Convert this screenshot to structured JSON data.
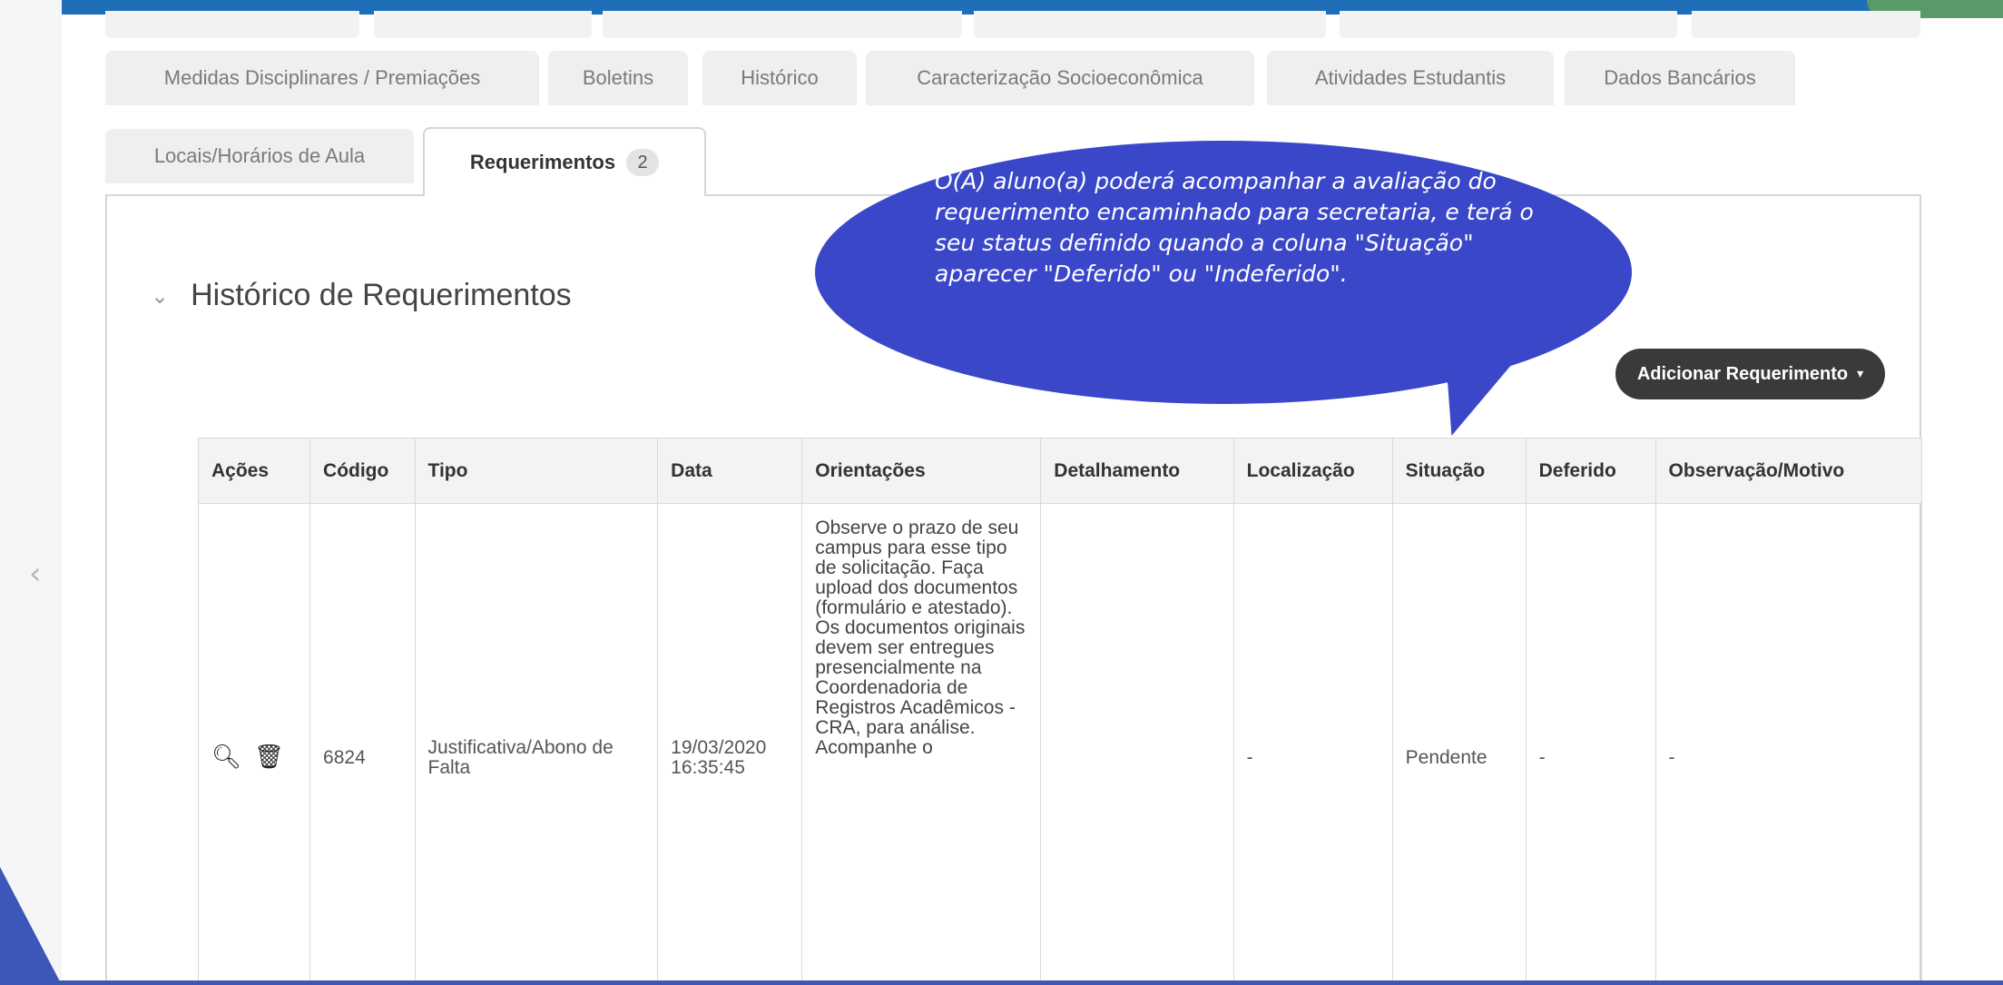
{
  "tabs_row1": [
    {
      "label": "Medidas Disciplinares / Premiações"
    },
    {
      "label": "Boletins"
    },
    {
      "label": "Histórico"
    },
    {
      "label": "Caracterização Socioeconômica"
    },
    {
      "label": "Atividades Estudantis"
    },
    {
      "label": "Dados Bancários"
    }
  ],
  "tabs_row2": [
    {
      "label": "Locais/Horários de Aula"
    },
    {
      "label": "Requerimentos",
      "badge": "2"
    }
  ],
  "section": {
    "title": "Histórico de Requerimentos"
  },
  "add_button": {
    "label": "Adicionar Requerimento"
  },
  "table": {
    "headers": [
      "Ações",
      "Código",
      "Tipo",
      "Data",
      "Orientações",
      "Detalhamento",
      "Localização",
      "Situação",
      "Deferido",
      "Observação/Motivo"
    ],
    "rows": [
      {
        "codigo": "6824",
        "tipo": "Justificativa/Abono de Falta",
        "data": "19/03/2020 16:35:45",
        "orientacoes": "Observe o prazo de seu campus para esse tipo de solicitação. Faça upload dos documentos (formulário e atestado). Os documentos originais devem ser entregues presencialmente na Coordenadoria de Registros Acadêmicos - CRA, para análise. Acompanhe o",
        "detalhamento": "",
        "localizacao": "-",
        "situacao": "Pendente",
        "deferido": "-",
        "observacao": "-"
      }
    ]
  },
  "annotation": {
    "text": "O(A) aluno(a) poderá acompanhar a avaliação do requerimento encaminhado para secretaria, e terá o seu status definido quando a coluna \"Situação\" aparecer \"Deferido\" ou \"Indeferido\"."
  },
  "icons": {
    "search": "magnifier-icon",
    "delete": "trash-icon",
    "nav_prev": "chevron-left-icon"
  },
  "colors": {
    "bubble": "#3a47c9",
    "top_bar": "#1f6fb8",
    "button_bg": "#3a3a3a"
  }
}
